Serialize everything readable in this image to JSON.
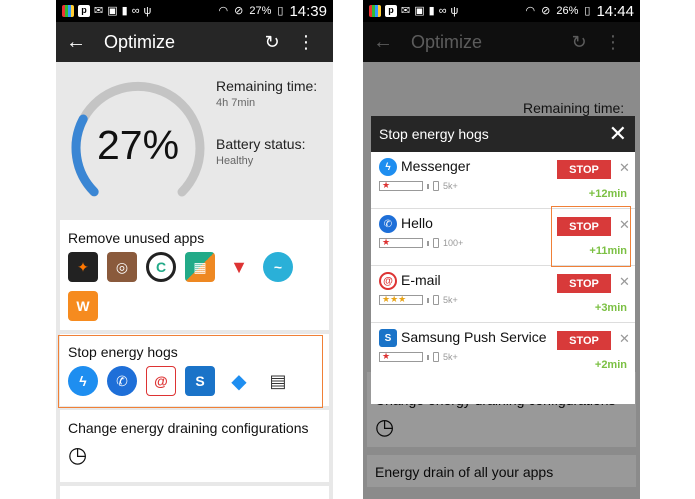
{
  "status_left": {
    "battery": "27%",
    "time": "14:39"
  },
  "status_right": {
    "battery": "26%",
    "time": "14:44"
  },
  "appbar": {
    "title": "Optimize"
  },
  "battery": {
    "percent": "27%",
    "level": 0.27,
    "remaining_label": "Remaining time:",
    "remaining_value": "4h 7min",
    "status_label": "Battery status:",
    "status_value": "Healthy"
  },
  "sections": {
    "remove_unused": "Remove unused apps",
    "stop_hogs": "Stop energy hogs",
    "change_config": "Change energy draining configurations",
    "energy_drain": "Energy drain of all your apps"
  },
  "dialog": {
    "title": "Stop energy hogs",
    "stop_label": "STOP",
    "items": [
      {
        "name": "Messenger",
        "downloads": "5k+",
        "gain": "+12min",
        "stars": "★"
      },
      {
        "name": "Hello",
        "downloads": "100+",
        "gain": "+11min",
        "stars": "★"
      },
      {
        "name": "E-mail",
        "downloads": "5k+",
        "gain": "+3min",
        "stars": "★★★"
      },
      {
        "name": "Samsung Push Service",
        "downloads": "5k+",
        "gain": "+2min",
        "stars": "★"
      }
    ]
  },
  "colors": {
    "accent": "#f08037",
    "stop": "#d83a3a",
    "gain": "#7bc043",
    "gauge": "#3a86d4"
  }
}
